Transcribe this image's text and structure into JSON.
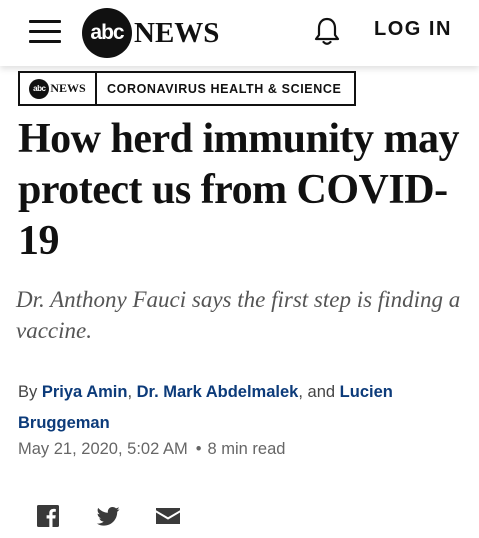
{
  "header": {
    "logo_mark": "abc",
    "logo_text": "NEWS",
    "login_label": "LOG IN"
  },
  "section_tag": {
    "logo_mark": "abc",
    "logo_text": "NEWS",
    "label": "CORONAVIRUS HEALTH & SCIENCE"
  },
  "article": {
    "headline": "How herd immunity may protect us from COVID-19",
    "dek": "Dr. Anthony Fauci says the first step is finding a vaccine.",
    "byline": {
      "prefix": "By",
      "authors": [
        "Priya Amin",
        "Dr. Mark Abdelmalek",
        "Lucien Bruggeman"
      ],
      "separator_comma": ",",
      "conjunction": ", and"
    },
    "date": "May 21, 2020, 5:02 AM",
    "dot": "•",
    "read_time": "8 min read"
  },
  "icons": {
    "menu": "hamburger-menu-icon",
    "notifications": "bell-icon",
    "share_facebook": "facebook-icon",
    "share_twitter": "twitter-icon",
    "share_email": "email-icon"
  },
  "colors": {
    "author_link": "#0c3b7a",
    "text": "#111111",
    "dek": "#555555"
  }
}
